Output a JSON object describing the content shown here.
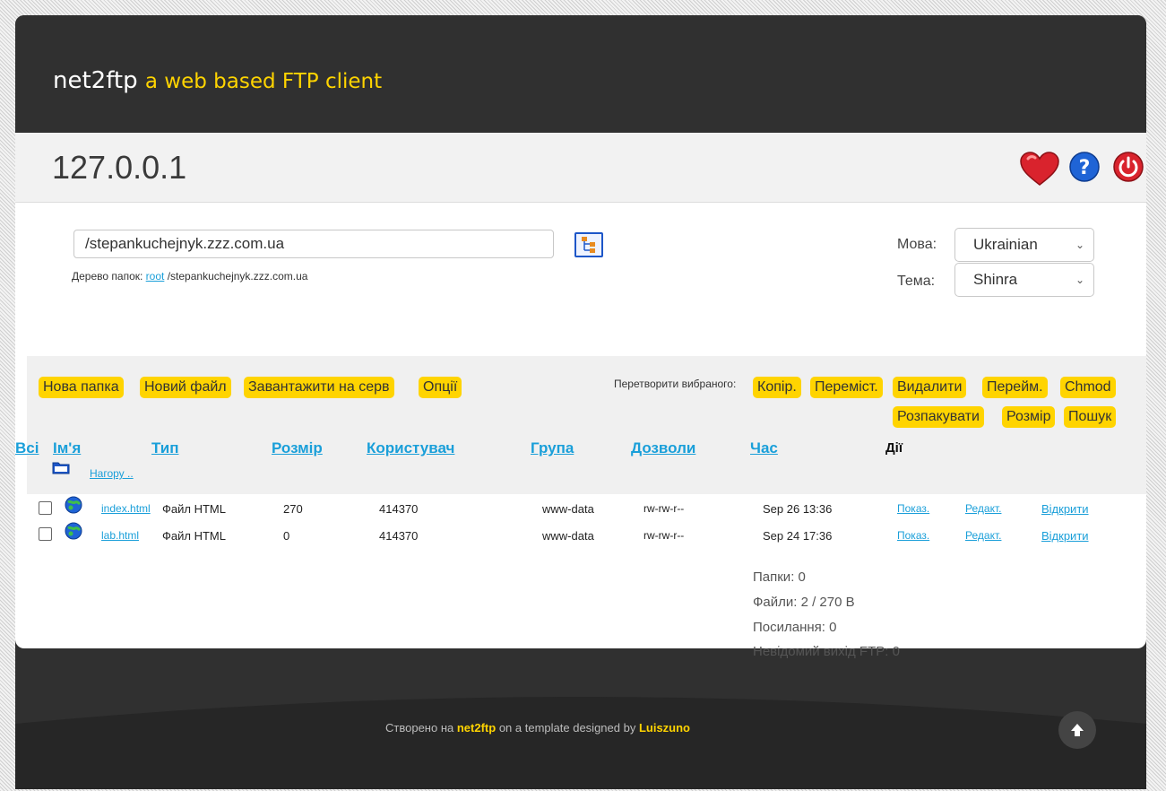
{
  "header": {
    "brand": "net2ftp",
    "tagline": "a web based FTP client"
  },
  "server": {
    "host": "127.0.0.1"
  },
  "icons": {
    "bookmark": "heart-icon",
    "help": "help-icon",
    "logout": "power-icon"
  },
  "path": {
    "value": "/stepankuchejnyk.zzz.com.ua",
    "tree_label": "Дерево папок:",
    "tree_root": "root",
    "tree_path": "/stepankuchejnyk.zzz.com.ua"
  },
  "settings": {
    "language_label": "Мова:",
    "language_value": "Ukrainian",
    "theme_label": "Тема:",
    "theme_value": "Shinra"
  },
  "toolbar": {
    "new_folder": "Нова папка",
    "new_file": "Новий файл",
    "upload": "Завантажити на серв",
    "options": "Опції",
    "transform_label": "Перетворити вибраного:",
    "copy": "Копір.",
    "move": "Переміст.",
    "delete": "Видалити",
    "rename": "Перейм.",
    "chmod": "Chmod",
    "unzip": "Розпакувати",
    "size": "Розмір",
    "search": "Пошук"
  },
  "table": {
    "headers": {
      "all": "Всі",
      "name": "Ім'я",
      "type": "Тип",
      "size": "Розмір",
      "user": "Користувач",
      "group": "Група",
      "perms": "Дозволи",
      "time": "Час",
      "actions": "Дії"
    },
    "up_label": "Нагору ..",
    "rows": [
      {
        "name": "index.html",
        "type": "Файл HTML",
        "size": "270",
        "user": "414370",
        "group": "www-data",
        "perms": "rw-rw-r--",
        "time": "Sep 26 13:36",
        "view": "Показ.",
        "edit": "Редакт.",
        "open": "Відкрити"
      },
      {
        "name": "lab.html",
        "type": "Файл HTML",
        "size": "0",
        "user": "414370",
        "group": "www-data",
        "perms": "rw-rw-r--",
        "time": "Sep 24 17:36",
        "view": "Показ.",
        "edit": "Редакт.",
        "open": "Відкрити"
      }
    ]
  },
  "stats": {
    "folders": "Папки: 0",
    "files": "Файли: 2 / 270 B",
    "links": "Посилання: 0",
    "unknown": "Невідомий вихід FTP: 0"
  },
  "footer": {
    "created": "Створено на",
    "app": "net2ftp",
    "middle": "on a template designed by",
    "author": "Luiszuno"
  },
  "colors": {
    "accent": "#ffd400",
    "link": "#1a9fd9",
    "dark": "#303030"
  }
}
